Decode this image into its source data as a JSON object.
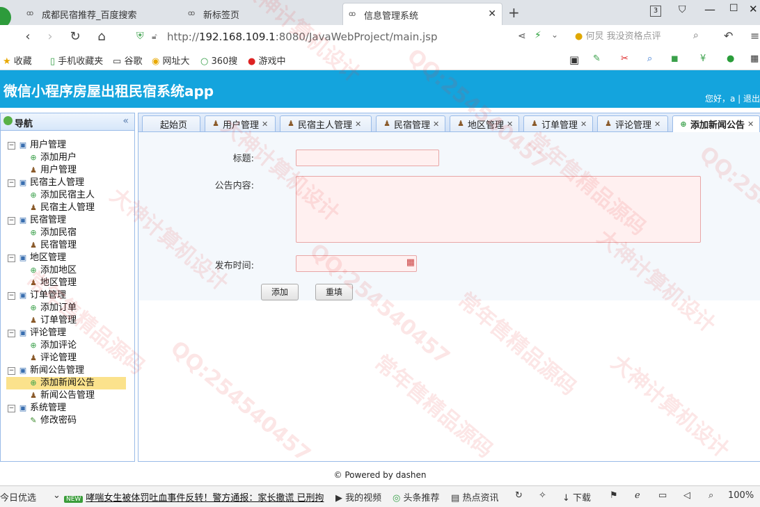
{
  "browser": {
    "tabs": [
      {
        "label": "成都民宿推荐_百度搜索",
        "active": false
      },
      {
        "label": "新标签页",
        "active": false
      },
      {
        "label": "信息管理系统",
        "active": true
      }
    ],
    "new_tab": "+",
    "tab_count": "3",
    "url_prefix": "http://",
    "url_host": "192.168.109.1",
    "url_rest": ":8080/JavaWebProject/main.jsp",
    "search_placeholder": "何炅 我没资格点评",
    "bookmarks": [
      "收藏",
      "手机收藏夹",
      "谷歌",
      "网址大",
      "360搜",
      "游戏中"
    ]
  },
  "app": {
    "title": "微信小程序房屋出租民宿系统app",
    "welcome": "您好，a | 退出"
  },
  "nav": {
    "title": "导航",
    "collapse": "«",
    "groups": [
      {
        "label": "用户管理",
        "items": [
          "添加用户",
          "用户管理"
        ]
      },
      {
        "label": "民宿主人管理",
        "items": [
          "添加民宿主人",
          "民宿主人管理"
        ]
      },
      {
        "label": "民宿管理",
        "items": [
          "添加民宿",
          "民宿管理"
        ]
      },
      {
        "label": "地区管理",
        "items": [
          "添加地区",
          "地区管理"
        ]
      },
      {
        "label": "订单管理",
        "items": [
          "添加订单",
          "订单管理"
        ]
      },
      {
        "label": "评论管理",
        "items": [
          "添加评论",
          "评论管理"
        ]
      },
      {
        "label": "新闻公告管理",
        "items": [
          "添加新闻公告",
          "新闻公告管理"
        ]
      },
      {
        "label": "系统管理",
        "items": [
          "修改密码"
        ]
      }
    ],
    "selected": "添加新闻公告"
  },
  "content_tabs": [
    {
      "label": "起始页",
      "closable": false,
      "active": false
    },
    {
      "label": "用户管理",
      "closable": true,
      "active": false
    },
    {
      "label": "民宿主人管理",
      "closable": true,
      "active": false
    },
    {
      "label": "民宿管理",
      "closable": true,
      "active": false
    },
    {
      "label": "地区管理",
      "closable": true,
      "active": false
    },
    {
      "label": "订单管理",
      "closable": true,
      "active": false
    },
    {
      "label": "评论管理",
      "closable": true,
      "active": false
    },
    {
      "label": "添加新闻公告",
      "closable": true,
      "active": true
    }
  ],
  "form": {
    "title_label": "标题:",
    "title_value": "",
    "content_label": "公告内容:",
    "content_value": "",
    "date_label": "发布时间:",
    "date_value": "",
    "submit": "添加",
    "reset": "重填"
  },
  "footer": "© Powered by dashen",
  "statusbar": {
    "left": "今日优选",
    "badge": "NEW",
    "news": "哮喘女生被体罚吐血事件反转！警方通报：家长撒谎 已刑拘",
    "video": "我的视频",
    "headline": "头条推荐",
    "hot": "热点资讯",
    "download": "下载",
    "zoom": "100%"
  },
  "watermarks": [
    "大神计算机设计",
    "QQ:254540457",
    "常年售精品源码"
  ]
}
